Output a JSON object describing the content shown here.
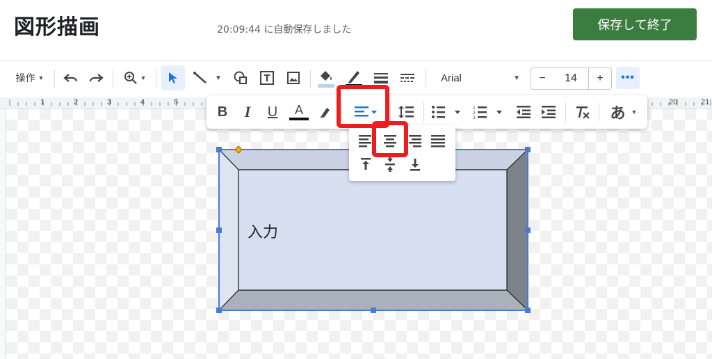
{
  "header": {
    "title": "図形描画",
    "saved_status": "20:09:44 に自動保存しました",
    "save_button": "保存して終了"
  },
  "toolbar": {
    "actions_label": "操作",
    "font_name": "Arial",
    "font_size": "14",
    "decrease": "−",
    "increase": "+",
    "more": "•••",
    "icons": [
      "undo-icon",
      "redo-icon",
      "zoom-icon",
      "select-icon",
      "line-icon",
      "shape-icon",
      "textbox-icon",
      "image-icon",
      "fill-color-icon",
      "line-color-icon",
      "line-weight-icon",
      "line-dash-icon"
    ]
  },
  "ruler": {
    "labels": [
      "1",
      "2",
      "3",
      "4",
      "5",
      "20",
      "21"
    ]
  },
  "format_bar": {
    "bold": "B",
    "italic": "I",
    "underline": "U",
    "text_color": "A",
    "input_tools": "あ"
  },
  "shape": {
    "text": "入力",
    "fill": "#d6e0f0",
    "edge_dark": "#7c838b",
    "edge_mid": "#a9b1ba"
  },
  "colors": {
    "accent": "#1a73e8",
    "save": "#3b7d3f",
    "highlight": "#ee1c1c"
  }
}
